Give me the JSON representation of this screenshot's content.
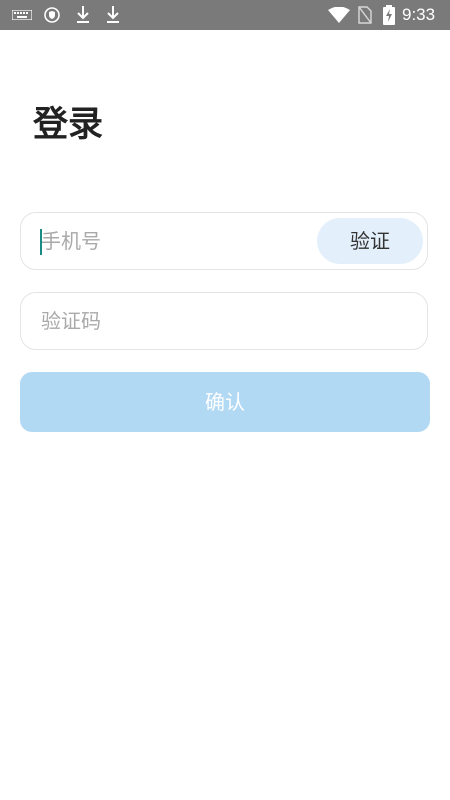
{
  "status_bar": {
    "time": "9:33",
    "icons": [
      "keyboard-icon",
      "shield-icon",
      "download-icon",
      "download-icon",
      "wifi-icon",
      "no-sim-icon",
      "battery-charging-icon"
    ]
  },
  "page": {
    "title": "登录"
  },
  "phone_field": {
    "placeholder": "手机号",
    "value": ""
  },
  "verify_button": {
    "label": "验证"
  },
  "code_field": {
    "placeholder": "验证码",
    "value": ""
  },
  "confirm_button": {
    "label": "确认"
  },
  "colors": {
    "status_bar": "#7a7a7a",
    "verify_button_bg": "#e3f0fb",
    "confirm_button_bg": "#b2d9f4",
    "caret": "#1a8c86"
  }
}
